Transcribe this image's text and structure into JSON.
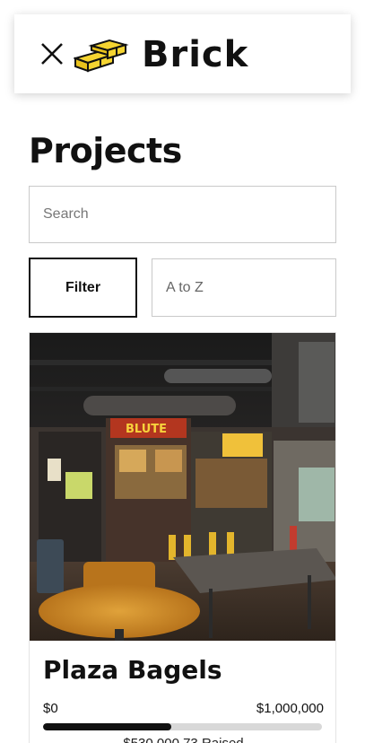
{
  "header": {
    "brand_name": "Brick",
    "logo_color": "#F5D431"
  },
  "page": {
    "title": "Projects"
  },
  "search": {
    "placeholder": "Search",
    "value": ""
  },
  "controls": {
    "filter_label": "Filter",
    "sort_value": "A to Z"
  },
  "projects": [
    {
      "title": "Plaza Bagels",
      "image": "restaurant-interior-photo",
      "min_label": "$0",
      "goal_label": "$1,000,000",
      "progress_fraction": 0.46,
      "raised_label": "$530,000.73 Raised"
    }
  ],
  "colors": {
    "accent": "#111111",
    "progress_track": "#D8D8D8",
    "logo_yellow": "#F5D431"
  }
}
